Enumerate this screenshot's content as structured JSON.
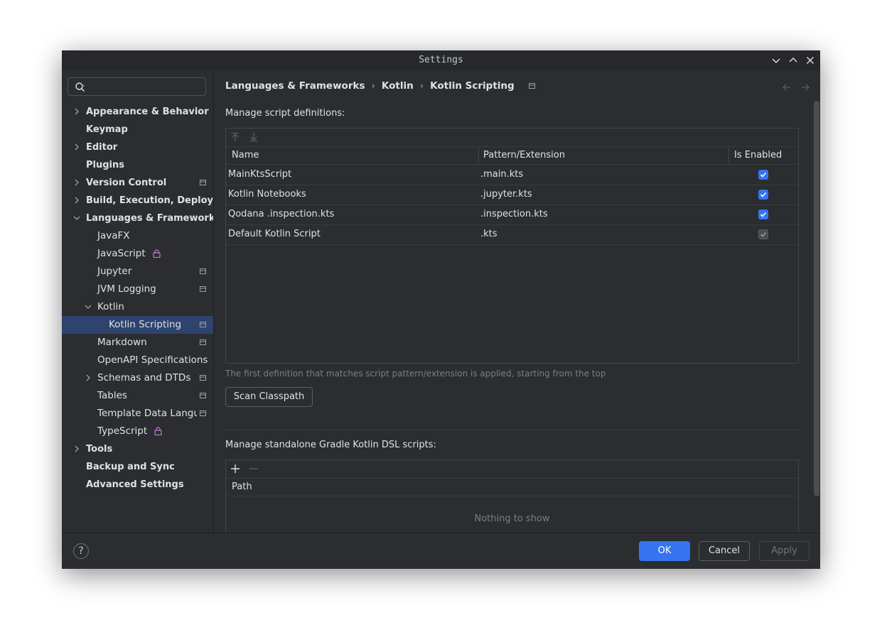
{
  "window": {
    "title": "Settings"
  },
  "sidebar": {
    "search": {
      "value": "",
      "placeholder": ""
    },
    "items": [
      {
        "label": "Appearance & Behavior"
      },
      {
        "label": "Keymap"
      },
      {
        "label": "Editor"
      },
      {
        "label": "Plugins"
      },
      {
        "label": "Version Control"
      },
      {
        "label": "Build, Execution, Deployment"
      },
      {
        "label": "Languages & Frameworks"
      },
      {
        "label": "JavaFX"
      },
      {
        "label": "JavaScript"
      },
      {
        "label": "Jupyter"
      },
      {
        "label": "JVM Logging"
      },
      {
        "label": "Kotlin"
      },
      {
        "label": "Kotlin Scripting"
      },
      {
        "label": "Markdown"
      },
      {
        "label": "OpenAPI Specifications"
      },
      {
        "label": "Schemas and DTDs"
      },
      {
        "label": "Tables"
      },
      {
        "label": "Template Data Languages"
      },
      {
        "label": "TypeScript"
      },
      {
        "label": "Tools"
      },
      {
        "label": "Backup and Sync"
      },
      {
        "label": "Advanced Settings"
      }
    ],
    "selected": "Kotlin Scripting"
  },
  "breadcrumb": {
    "items": [
      "Languages & Frameworks",
      "Kotlin",
      "Kotlin Scripting"
    ],
    "separator": "›"
  },
  "scripts": {
    "label": "Manage script definitions:",
    "columns": [
      "Name",
      "Pattern/Extension",
      "Is Enabled"
    ],
    "rows": [
      {
        "name": "MainKtsScript",
        "pattern": ".main.kts",
        "enabled": true
      },
      {
        "name": "Kotlin Notebooks",
        "pattern": ".jupyter.kts",
        "enabled": true
      },
      {
        "name": "Qodana .inspection.kts",
        "pattern": ".inspection.kts",
        "enabled": true
      },
      {
        "name": "Default Kotlin Script",
        "pattern": ".kts",
        "enabled": true,
        "disabled": true
      }
    ],
    "hint": "The first definition that matches script pattern/extension is applied, starting from the top",
    "scan_button": "Scan Classpath"
  },
  "gradle": {
    "label": "Manage standalone Gradle Kotlin DSL scripts:",
    "columns": [
      "Path"
    ],
    "empty_text": "Nothing to show"
  },
  "footer": {
    "help": "?",
    "ok": "OK",
    "cancel": "Cancel",
    "apply": "Apply"
  },
  "colors": {
    "accent": "#3574f0",
    "selection": "#2e436e",
    "background": "#2b2d30",
    "lock": "#c77dd7"
  }
}
